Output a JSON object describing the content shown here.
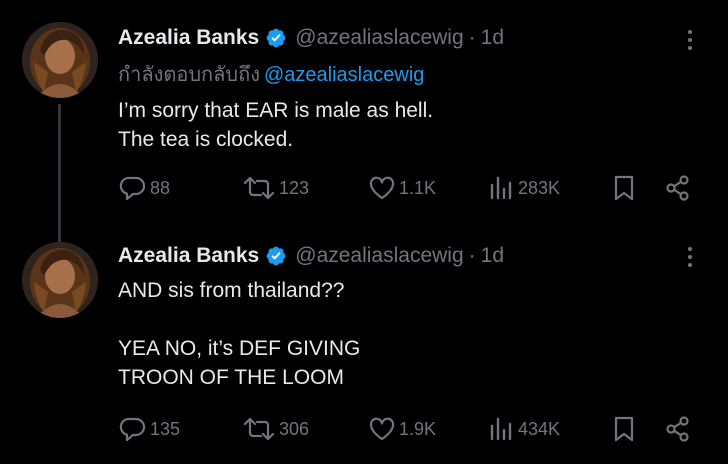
{
  "tweets": [
    {
      "display_name": "Azealia Banks",
      "handle": "@azealiaslacewig",
      "separator": "·",
      "time": "1d",
      "reply_prefix": "กำลังตอบกลับถึง",
      "reply_mention": "@azealiaslacewig",
      "lines": [
        "I’m sorry that EAR is male as hell.",
        "The tea is clocked."
      ],
      "replies": "88",
      "retweets": "123",
      "likes": "1.1K",
      "views": "283K"
    },
    {
      "display_name": "Azealia Banks",
      "handle": "@azealiaslacewig",
      "separator": "·",
      "time": "1d",
      "lines": [
        "AND sis from thailand??",
        "",
        "YEA NO, it’s DEF GIVING",
        "TROON OF THE LOOM"
      ],
      "replies": "135",
      "retweets": "306",
      "likes": "1.9K",
      "views": "434K"
    }
  ],
  "colors": {
    "background": "#000000",
    "text": "#e7e9ea",
    "muted": "#71767b",
    "accent": "#1d9bf0",
    "thread_line": "#333639"
  },
  "icons": {
    "verified": "verified-badge-icon",
    "more": "more-options-icon",
    "reply": "reply-icon",
    "retweet": "retweet-icon",
    "like": "heart-icon",
    "views": "views-icon",
    "bookmark": "bookmark-icon",
    "share": "share-icon"
  }
}
